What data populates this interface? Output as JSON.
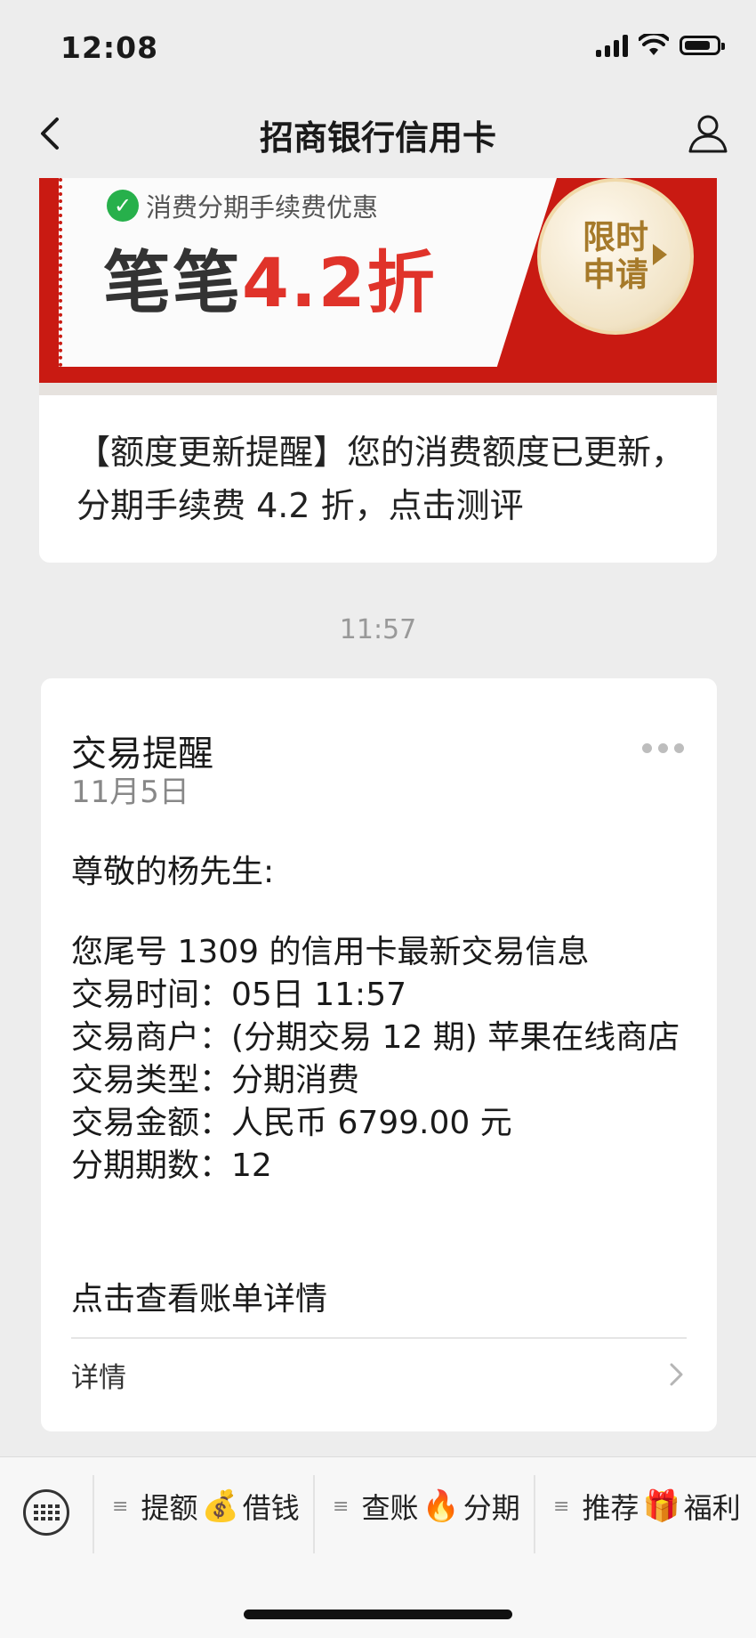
{
  "status_bar": {
    "time": "12:08"
  },
  "nav": {
    "title": "招商银行信用卡"
  },
  "article": {
    "banner_sub": "消费分期手续费优惠",
    "banner_big_prefix": "笔笔",
    "banner_big_highlight": "4.2折",
    "badge_line1": "限时",
    "badge_line2": "申请",
    "description": "【额度更新提醒】您的消费额度已更新，分期手续费 4.2 折，点击测评"
  },
  "timestamp": "11:57",
  "message": {
    "title": "交易提醒",
    "date": "11月5日",
    "greeting": "尊敬的杨先生:",
    "lines": [
      "您尾号 1309 的信用卡最新交易信息",
      "交易时间：05日 11:57",
      "交易商户：(分期交易 12 期) 苹果在线商店",
      "交易类型：分期消费",
      "交易金额：人民币 6799.00 元",
      "分期期数：12"
    ],
    "cta": "点击查看账单详情",
    "detail_label": "详情"
  },
  "bottom_menu": [
    {
      "left": "提额",
      "emoji": "💰",
      "right": "借钱"
    },
    {
      "left": "查账",
      "emoji": "🔥",
      "right": "分期"
    },
    {
      "left": "推荐",
      "emoji": "🎁",
      "right": "福利"
    }
  ]
}
